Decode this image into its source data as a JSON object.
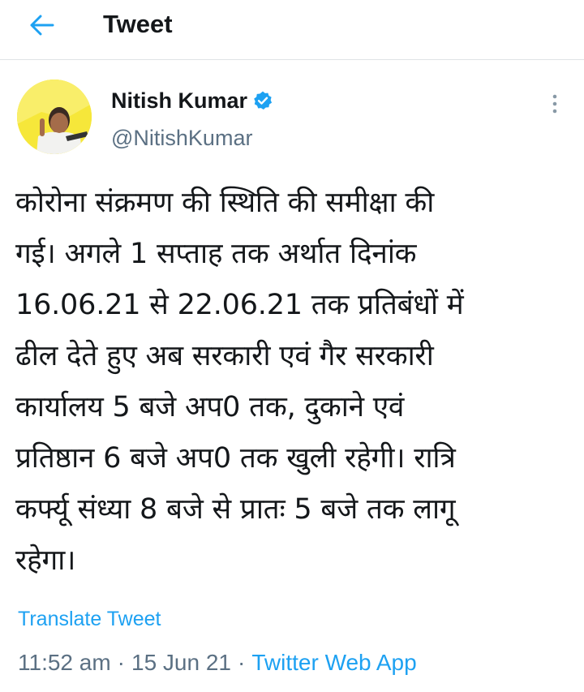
{
  "header": {
    "back_icon": "arrow-left-icon",
    "title": "Tweet"
  },
  "colors": {
    "accent": "#1DA1F2",
    "text": "#14171A",
    "secondary": "#5B7083"
  },
  "tweet": {
    "author": {
      "name": "Nitish Kumar",
      "handle": "@NitishKumar",
      "verified_icon": "verified-badge-icon"
    },
    "menu_icon": "more-vertical-icon",
    "lines": [
      "कोरोना संक्रमण की स्थिति की समीक्षा की",
      "गई। अगले 1 सप्ताह तक अर्थात दिनांक",
      "16.06.21 से 22.06.21 तक प्रतिबंधों में",
      "ढील देते हुए अब सरकारी एवं गैर सरकारी",
      "कार्यालय 5 बजे अप0 तक, दुकाने एवं",
      "प्रतिष्ठान 6 बजे अप0 तक खुली रहेगी। रात्रि",
      "कर्फ्यू संध्या 8 बजे से प्रातः 5 बजे तक लागू",
      "रहेगा।"
    ],
    "translate_label": "Translate Tweet",
    "time": "11:52 am",
    "separator": "·",
    "date": "15 Jun 21",
    "source": "Twitter Web App"
  }
}
